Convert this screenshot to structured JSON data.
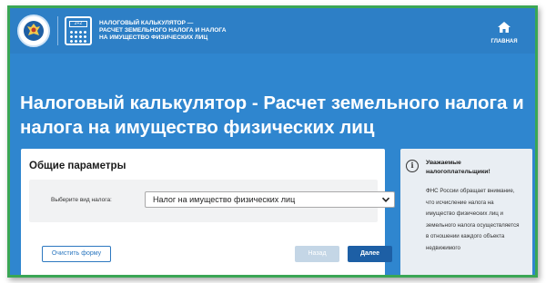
{
  "header": {
    "brand_lines": [
      "Налоговый калькулятор —",
      "расчет земельного налога и налога",
      "на имущество физических лиц"
    ],
    "calc_screen_text": "2+2",
    "home_label": "Главная"
  },
  "page_title": "Налоговый калькулятор - Расчет земельного налога и налога на имущество физических лиц",
  "form": {
    "section_title": "Общие параметры",
    "tax_type_label": "Выберите вид налога:",
    "tax_type_selected": "Налог на имущество физических лиц",
    "clear_label": "Очистить форму",
    "back_label": "Назад",
    "next_label": "Далее"
  },
  "info": {
    "icon_glyph": "i",
    "title": "Уважаемые налогоплательщики!",
    "text": "ФНС России обращает внимание, что исчисление налога на имущество физических лиц и земельного налога осуществляется в отношении каждого объекта недвижимого"
  },
  "colors": {
    "header_bg": "#2d7fc6",
    "page_bg": "#2f86cf",
    "frame_border": "#3aa655",
    "primary_button": "#1d5fa5",
    "disabled_button": "#c4d6e6"
  },
  "icons": {
    "emblem": "fns-emblem-icon",
    "calculator": "calculator-icon",
    "home": "home-icon",
    "dropdown": "chevron-down-icon",
    "info": "info-icon"
  }
}
